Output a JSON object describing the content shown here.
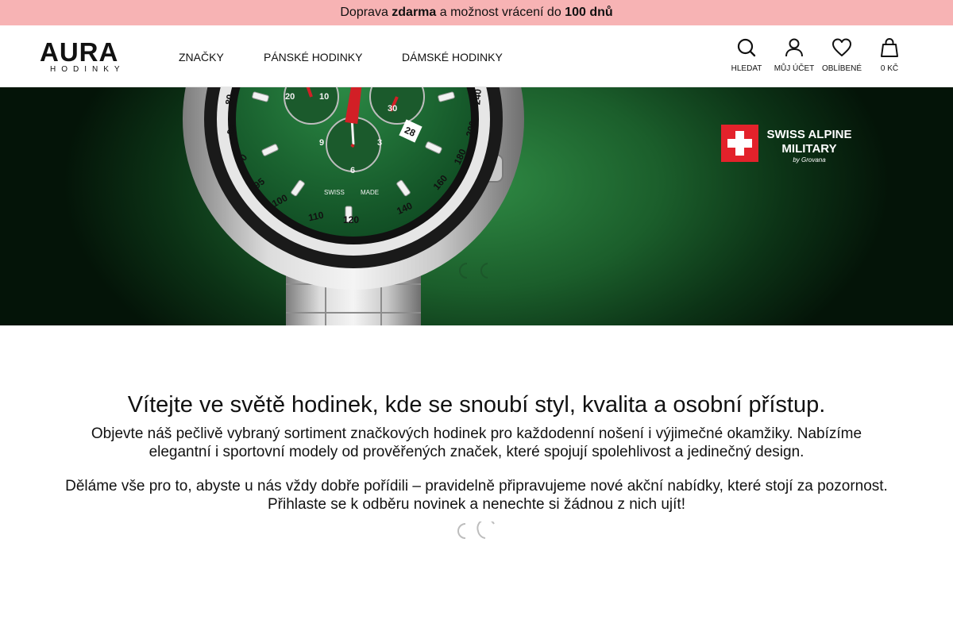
{
  "promo": {
    "prefix": "Doprava ",
    "free": "zdarma",
    "middle": " a možnost vrácení do ",
    "days": "100 dnů"
  },
  "header": {
    "logo": {
      "word": "AURA",
      "sub": "HODINKY"
    },
    "nav": [
      "ZNAČKY",
      "PÁNSKÉ HODINKY",
      "DÁMSKÉ HODINKY"
    ],
    "actions": {
      "search": "HLEDAT",
      "account": "MŮJ ÚČET",
      "favorites": "OBLÍBENÉ",
      "cart": "0 KČ"
    }
  },
  "hero": {
    "brand": {
      "line1": "SWISS ALPINE",
      "line2": "MILITARY",
      "line3": "by Grovana"
    },
    "watch": {
      "date": "28",
      "bezel": [
        "80",
        "85",
        "90",
        "95",
        "100",
        "110",
        "120",
        "140",
        "160",
        "180",
        "200",
        "240"
      ],
      "dial_texts": [
        "20",
        "10",
        "30",
        "9",
        "3",
        "6",
        "SWISS",
        "MADE"
      ]
    },
    "colors": {
      "background": "#1b5e2b",
      "dial": "#1f6a34",
      "accent_red": "#d21f26"
    }
  },
  "content": {
    "title": "Vítejte ve světě hodinek, kde se snoubí styl, kvalita a osobní přístup.",
    "paragraph1": "Objevte náš pečlivě vybraný sortiment značkových hodinek pro každodenní nošení i výjimečné okamžiky. Nabízíme elegantní i sportovní modely od prověřených značek, které spojují spolehlivost a jedinečný design.",
    "paragraph2": "Děláme vše pro to, abyste u nás vždy dobře pořídili – pravidelně připravujeme nové akční nabídky, které stojí za pozornost. Přihlaste se k odběru novinek a nenechte si žádnou z nich ujít!"
  },
  "icons": [
    "search-icon",
    "user-icon",
    "heart-icon",
    "bag-icon",
    "loading-spinner-icon"
  ],
  "colors": {
    "promo_bg": "#f7b3b4",
    "text": "#111111"
  }
}
